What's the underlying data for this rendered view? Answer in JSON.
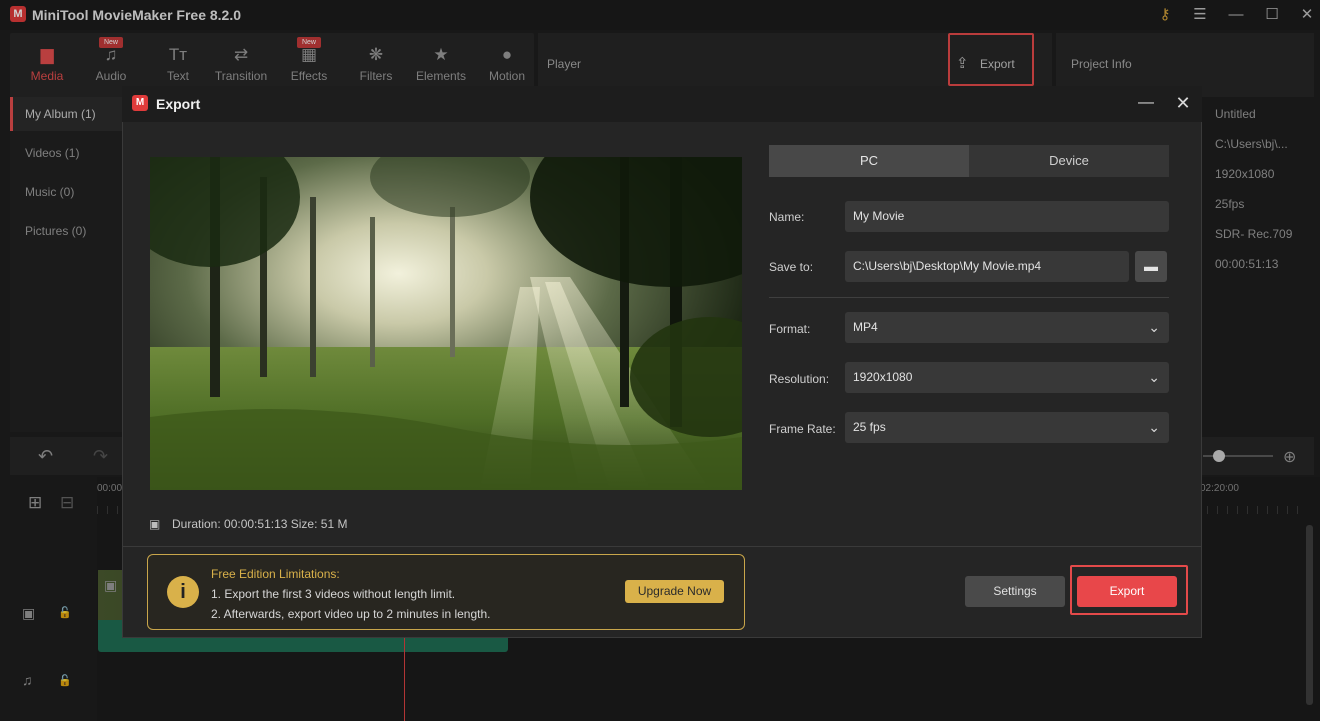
{
  "app": {
    "title": "MiniTool MovieMaker Free 8.2.0",
    "logo_glyph": "M",
    "key_icon": "key-icon",
    "menu_icon": "menu-icon",
    "min_glyph": "—",
    "max_glyph": "☐",
    "close_glyph": "✕"
  },
  "toolbar": {
    "items": [
      {
        "label": "Media",
        "icon": "media-icon",
        "glyph": "▆",
        "active": true
      },
      {
        "label": "Audio",
        "icon": "audio-icon",
        "glyph": "♫",
        "badge": "New"
      },
      {
        "label": "Text",
        "icon": "text-icon",
        "glyph": "Tт"
      },
      {
        "label": "Transition",
        "icon": "transition-icon",
        "glyph": "⇄"
      },
      {
        "label": "Effects",
        "icon": "effects-icon",
        "glyph": "▦",
        "badge": "New"
      },
      {
        "label": "Filters",
        "icon": "filters-icon",
        "glyph": "❋"
      },
      {
        "label": "Elements",
        "icon": "elements-icon",
        "glyph": "★"
      },
      {
        "label": "Motion",
        "icon": "motion-icon",
        "glyph": "●"
      }
    ]
  },
  "player": {
    "label": "Player"
  },
  "top_export": {
    "label": "Export",
    "glyph": "⇪"
  },
  "project_info": {
    "label": "Project Info",
    "values": [
      "Untitled",
      "C:\\Users\\bj\\...",
      "1920x1080",
      "25fps",
      "SDR- Rec.709",
      "00:00:51:13"
    ]
  },
  "album": {
    "items": [
      {
        "label": "My Album (1)",
        "active": true
      },
      {
        "label": "Videos (1)"
      },
      {
        "label": "Music (0)"
      },
      {
        "label": "Pictures (0)"
      }
    ]
  },
  "timeline": {
    "start_time": "00:00",
    "end_time": "02:20:00",
    "undo_glyph": "↶",
    "redo_glyph": "↷",
    "zoom_in_glyph": "⊕",
    "add_track_glyph": "⊞",
    "remove_track_glyph": "⊟",
    "video_track_glyph": "▣",
    "audio_track_glyph": "♫",
    "lock_glyph": "🔓"
  },
  "dialog": {
    "title": "Export",
    "logo_glyph": "M",
    "min_glyph": "—",
    "close_glyph": "✕",
    "tabs": {
      "pc": "PC",
      "device": "Device"
    },
    "fields": {
      "name_label": "Name:",
      "name_value": "My Movie",
      "saveto_label": "Save to:",
      "saveto_value": "C:\\Users\\bj\\Desktop\\My Movie.mp4",
      "folder_glyph": "▬",
      "format_label": "Format:",
      "format_value": "MP4",
      "resolution_label": "Resolution:",
      "resolution_value": "1920x1080",
      "framerate_label": "Frame Rate:",
      "framerate_value": "25 fps",
      "chevron_glyph": "⌄"
    },
    "duration": {
      "text": "Duration:  00:00:51:13  Size:  51 M",
      "glyph": "▣"
    },
    "limits": {
      "glyph": "i",
      "title": "Free Edition Limitations:",
      "line1": "1. Export the first 3 videos without length limit.",
      "line2": "2. Afterwards, export video up to 2 minutes in length.",
      "upgrade": "Upgrade Now"
    },
    "settings_label": "Settings",
    "export_label": "Export"
  },
  "colors": {
    "accent_red": "#e8474a",
    "highlight_red": "#e34a4a",
    "gold": "#d9b14a",
    "dialog_bg": "#252525"
  }
}
